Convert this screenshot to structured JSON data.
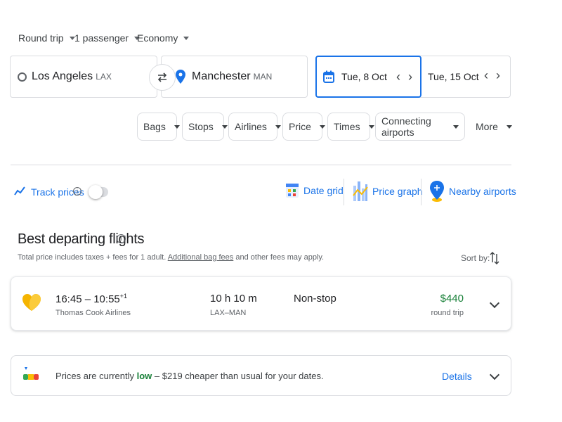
{
  "search": {
    "trip_type": "Round trip",
    "passengers": "1 passenger",
    "cabin": "Economy",
    "origin_city": "Los Angeles",
    "origin_code": "LAX",
    "destination_city": "Manchester",
    "destination_code": "MAN",
    "depart_date": "Tue, 8 Oct",
    "return_date": "Tue, 15 Oct"
  },
  "filters": [
    "Bags",
    "Stops",
    "Airlines",
    "Price",
    "Times",
    "Connecting airports"
  ],
  "more_label": "More",
  "tools": {
    "track_prices": "Track prices",
    "date_grid": "Date grid",
    "price_graph": "Price graph",
    "nearby_airports": "Nearby airports"
  },
  "results": {
    "heading": "Best departing flights",
    "subtext_before": "Total price includes taxes + fees for 1 adult.",
    "subtext_link": "Additional bag fees",
    "subtext_after": "and other fees may apply.",
    "sort_label": "Sort by:"
  },
  "flight": {
    "times": "16:45 – 10:55",
    "day_offset": "+1",
    "airline": "Thomas Cook Airlines",
    "duration": "10 h 10 m",
    "route": "LAX–MAN",
    "stops": "Non-stop",
    "price": "$440",
    "price_note": "round trip",
    "price_color": "#188038"
  },
  "price_insight": {
    "prefix": "Prices are currently",
    "level": "low",
    "suffix": "– $219 cheaper than usual for your dates.",
    "details": "Details"
  },
  "colors": {
    "accent": "#1a73e8",
    "low_green": "#188038",
    "airline_logo": "#f5b400"
  }
}
